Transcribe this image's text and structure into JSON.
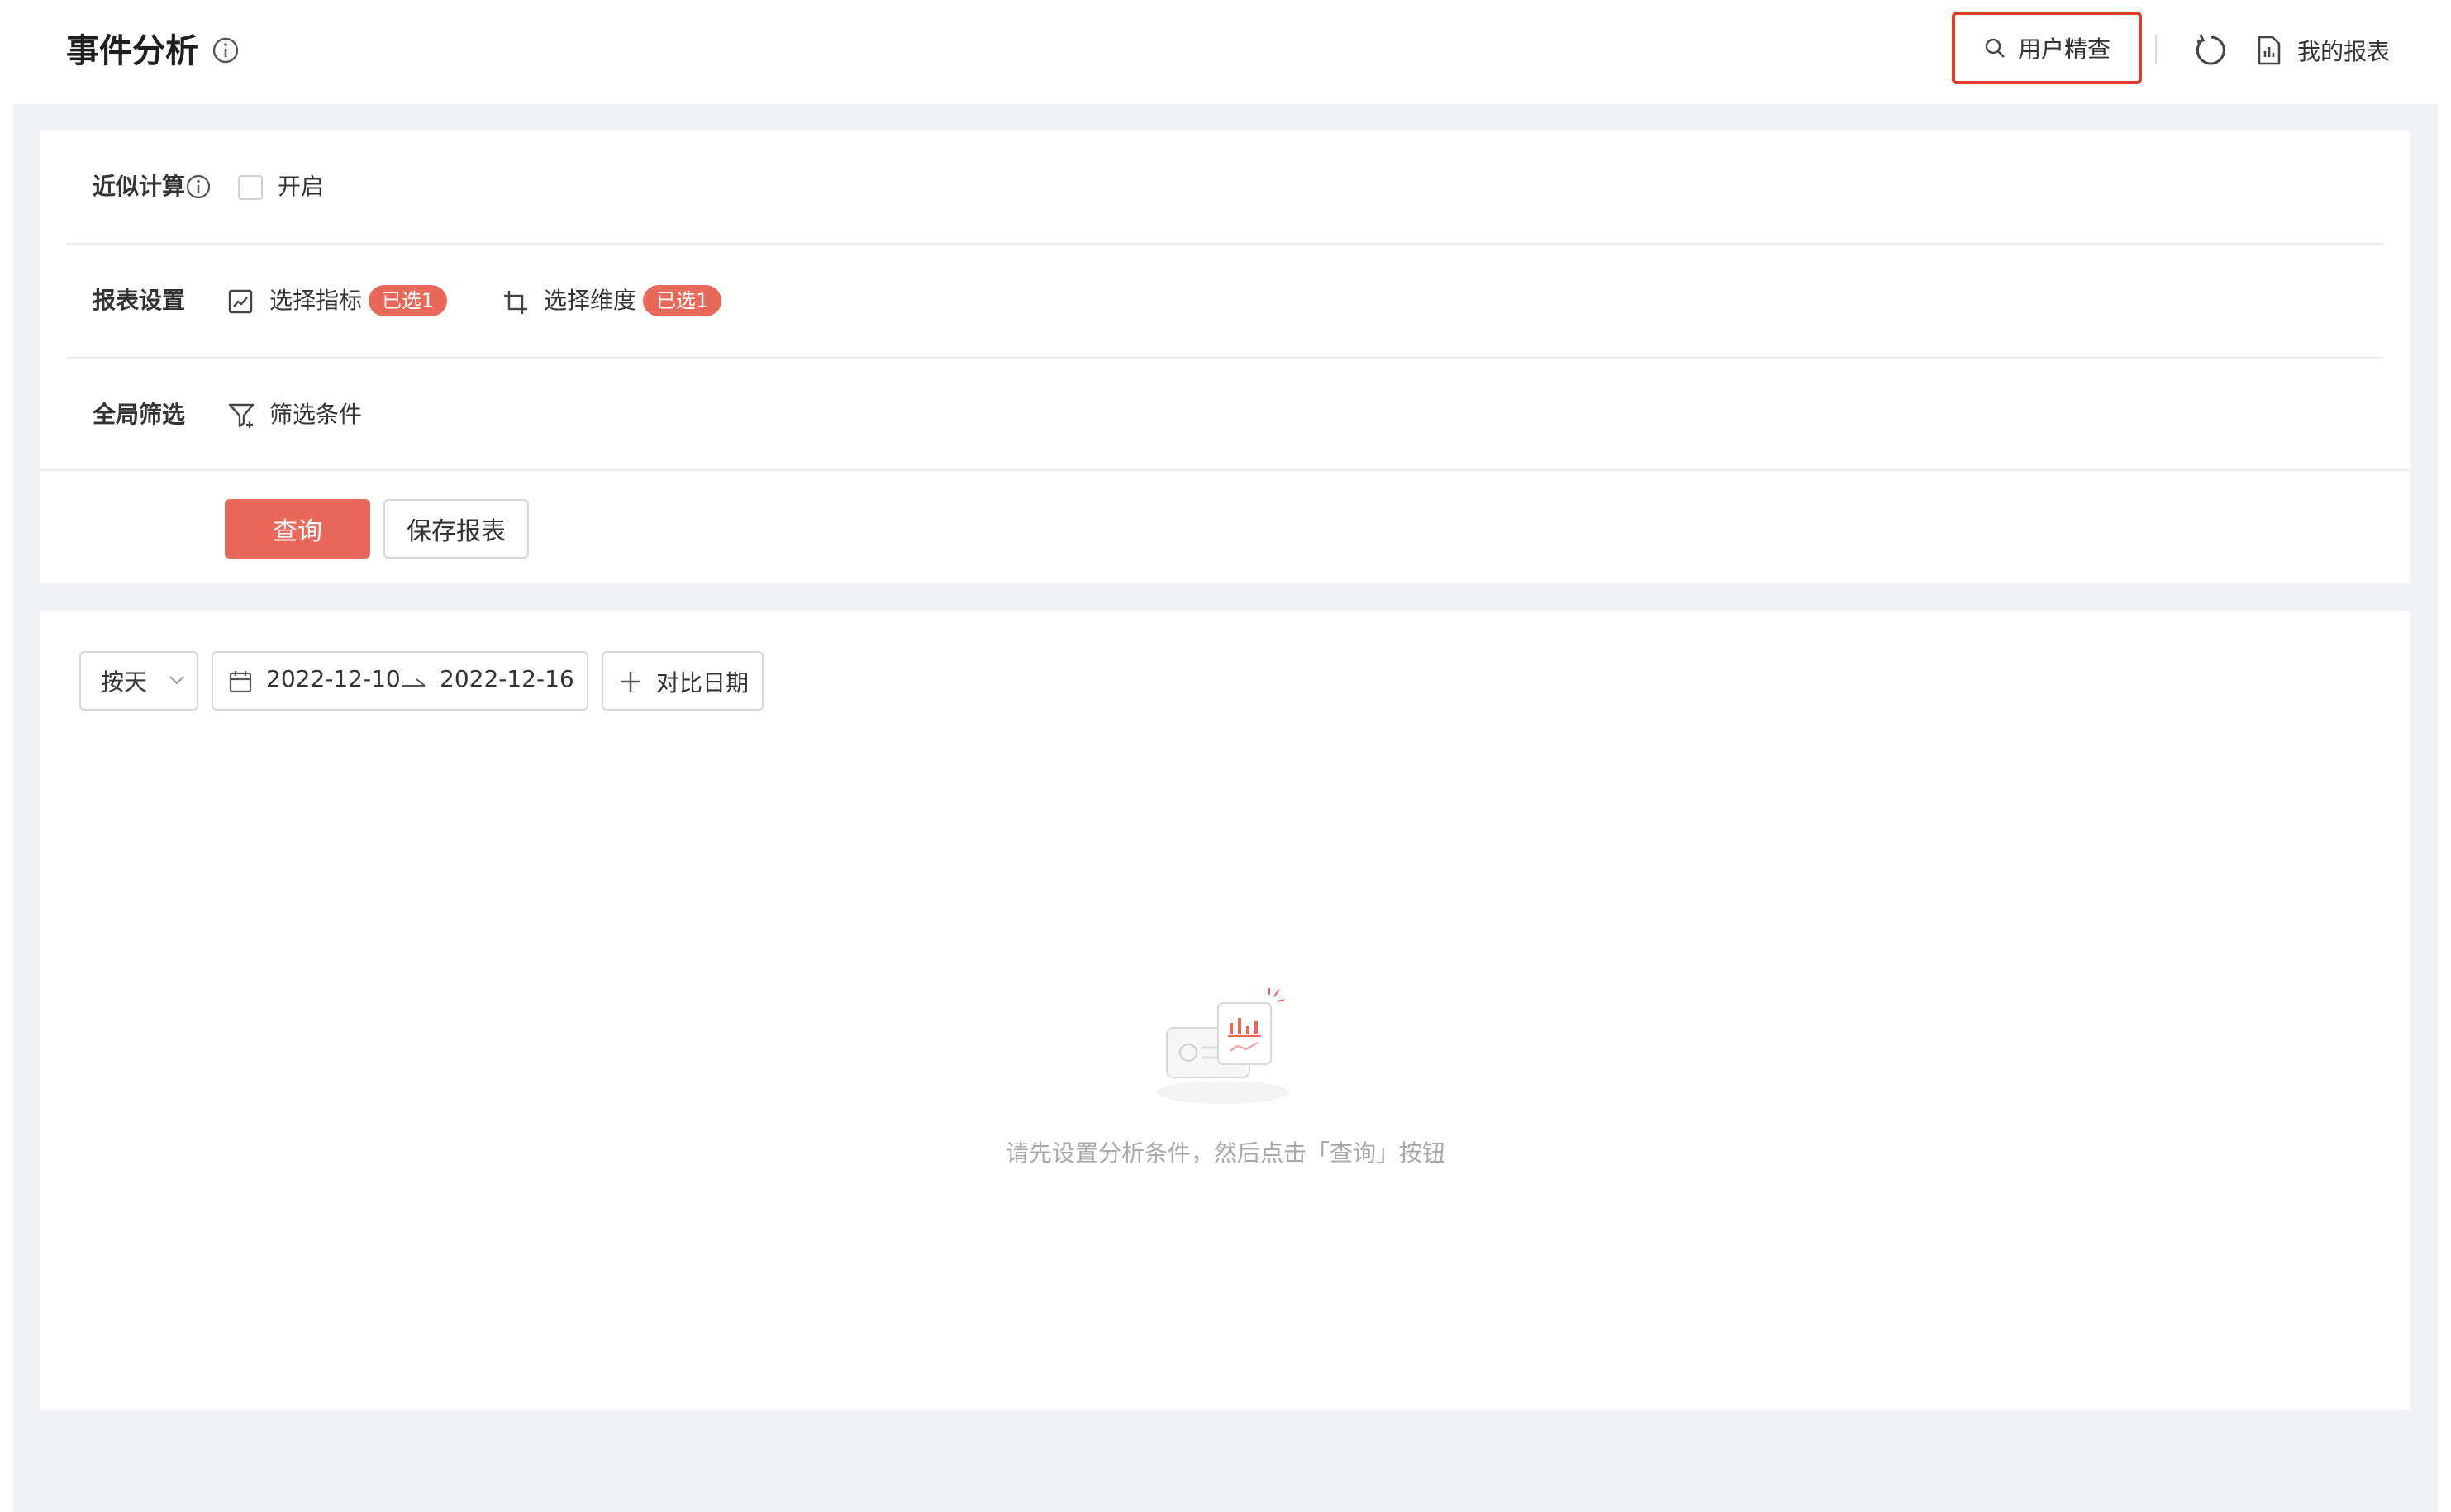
{
  "header": {
    "title": "事件分析",
    "user_inspect_label": "用户精查",
    "my_reports_label": "我的报表"
  },
  "settings": {
    "approx": {
      "label": "近似计算",
      "checkbox_label": "开启",
      "checked": false
    },
    "report": {
      "label": "报表设置",
      "metric_label": "选择指标",
      "metric_badge": "已选1",
      "dimension_label": "选择维度",
      "dimension_badge": "已选1"
    },
    "filter": {
      "label": "全局筛选",
      "condition_label": "筛选条件"
    },
    "actions": {
      "query_label": "查询",
      "save_label": "保存报表"
    }
  },
  "results": {
    "granularity": "按天",
    "date_start": "2022-12-10",
    "date_end": "2022-12-16",
    "compare_label": "对比日期",
    "empty_message": "请先设置分析条件，然后点击「查询」按钮"
  },
  "colors": {
    "accent": "#e8685a",
    "highlight_border": "#e23b2e",
    "canvas_bg": "#f0f1f4"
  },
  "icons": [
    "info-icon",
    "search-icon",
    "refresh-icon",
    "report-icon",
    "metric-icon",
    "dimension-icon",
    "filter-icon",
    "calendar-icon",
    "chevron-down-icon",
    "arrow-right-icon",
    "plus-icon",
    "empty-chart-illustration"
  ]
}
